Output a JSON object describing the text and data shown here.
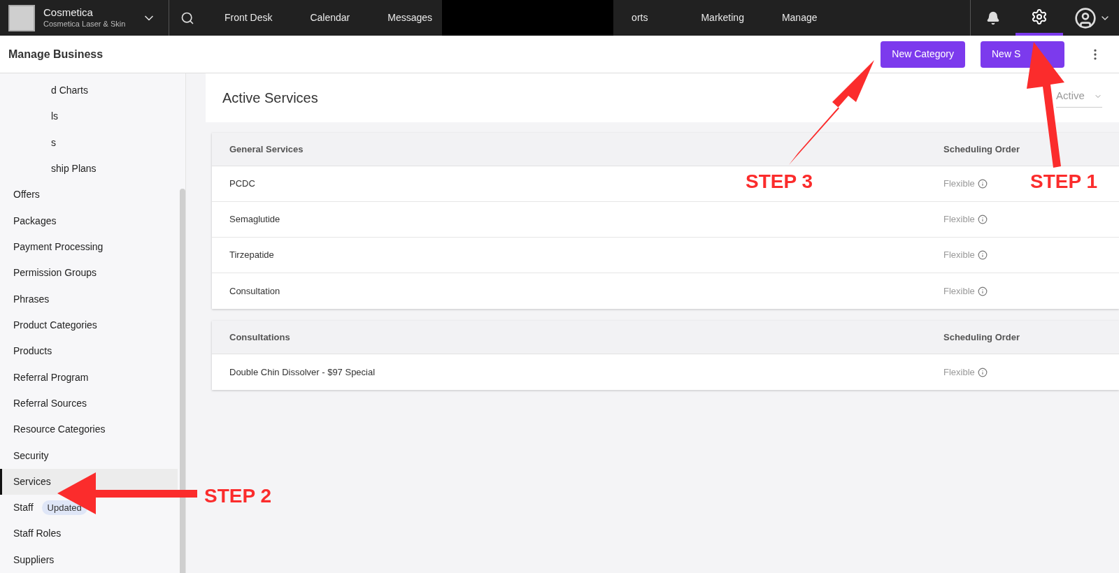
{
  "topbar": {
    "business_name": "Cosmetica",
    "location": "Cosmetica Laser & Skin",
    "nav": [
      {
        "label": "Front Desk"
      },
      {
        "label": "Calendar"
      },
      {
        "label": "Messages"
      },
      {
        "label": "orts"
      },
      {
        "label": "Marketing"
      },
      {
        "label": "Manage"
      }
    ],
    "settings_selected": true
  },
  "header": {
    "title": "Manage Business",
    "buttons": [
      {
        "label": "New Category"
      },
      {
        "label": "New S"
      }
    ]
  },
  "sidebar": {
    "items": [
      {
        "label": "d Charts",
        "selected": false
      },
      {
        "label": "ls",
        "selected": false
      },
      {
        "label": "s",
        "selected": false
      },
      {
        "label": "ship Plans",
        "selected": false
      },
      {
        "label": "Offers",
        "selected": false
      },
      {
        "label": "Packages",
        "selected": false
      },
      {
        "label": "Payment Processing",
        "selected": false
      },
      {
        "label": "Permission Groups",
        "selected": false
      },
      {
        "label": "Phrases",
        "selected": false
      },
      {
        "label": "Product Categories",
        "selected": false
      },
      {
        "label": "Products",
        "selected": false
      },
      {
        "label": "Referral Program",
        "selected": false
      },
      {
        "label": "Referral Sources",
        "selected": false
      },
      {
        "label": "Resource Categories",
        "selected": false
      },
      {
        "label": "Security",
        "selected": false
      },
      {
        "label": "Services",
        "selected": true
      },
      {
        "label": "Staff",
        "selected": false,
        "badge": "Updated"
      },
      {
        "label": "Staff Roles",
        "selected": false
      },
      {
        "label": "Suppliers",
        "selected": false
      }
    ]
  },
  "content": {
    "title": "Active Services",
    "filter": "Active",
    "groups": [
      {
        "name": "General Services",
        "column_2": "Scheduling Order",
        "rows": [
          {
            "name": "PCDC",
            "order": "Flexible"
          },
          {
            "name": "Semaglutide",
            "order": "Flexible"
          },
          {
            "name": "Tirzepatide",
            "order": "Flexible"
          },
          {
            "name": "Consultation",
            "order": "Flexible"
          }
        ]
      },
      {
        "name": "Consultations",
        "column_2": "Scheduling Order",
        "rows": [
          {
            "name": "Double Chin Dissolver - $97 Special",
            "order": "Flexible"
          }
        ]
      }
    ]
  },
  "annotations": [
    {
      "label": "STEP 1"
    },
    {
      "label": "STEP 2"
    },
    {
      "label": "STEP 3"
    }
  ]
}
